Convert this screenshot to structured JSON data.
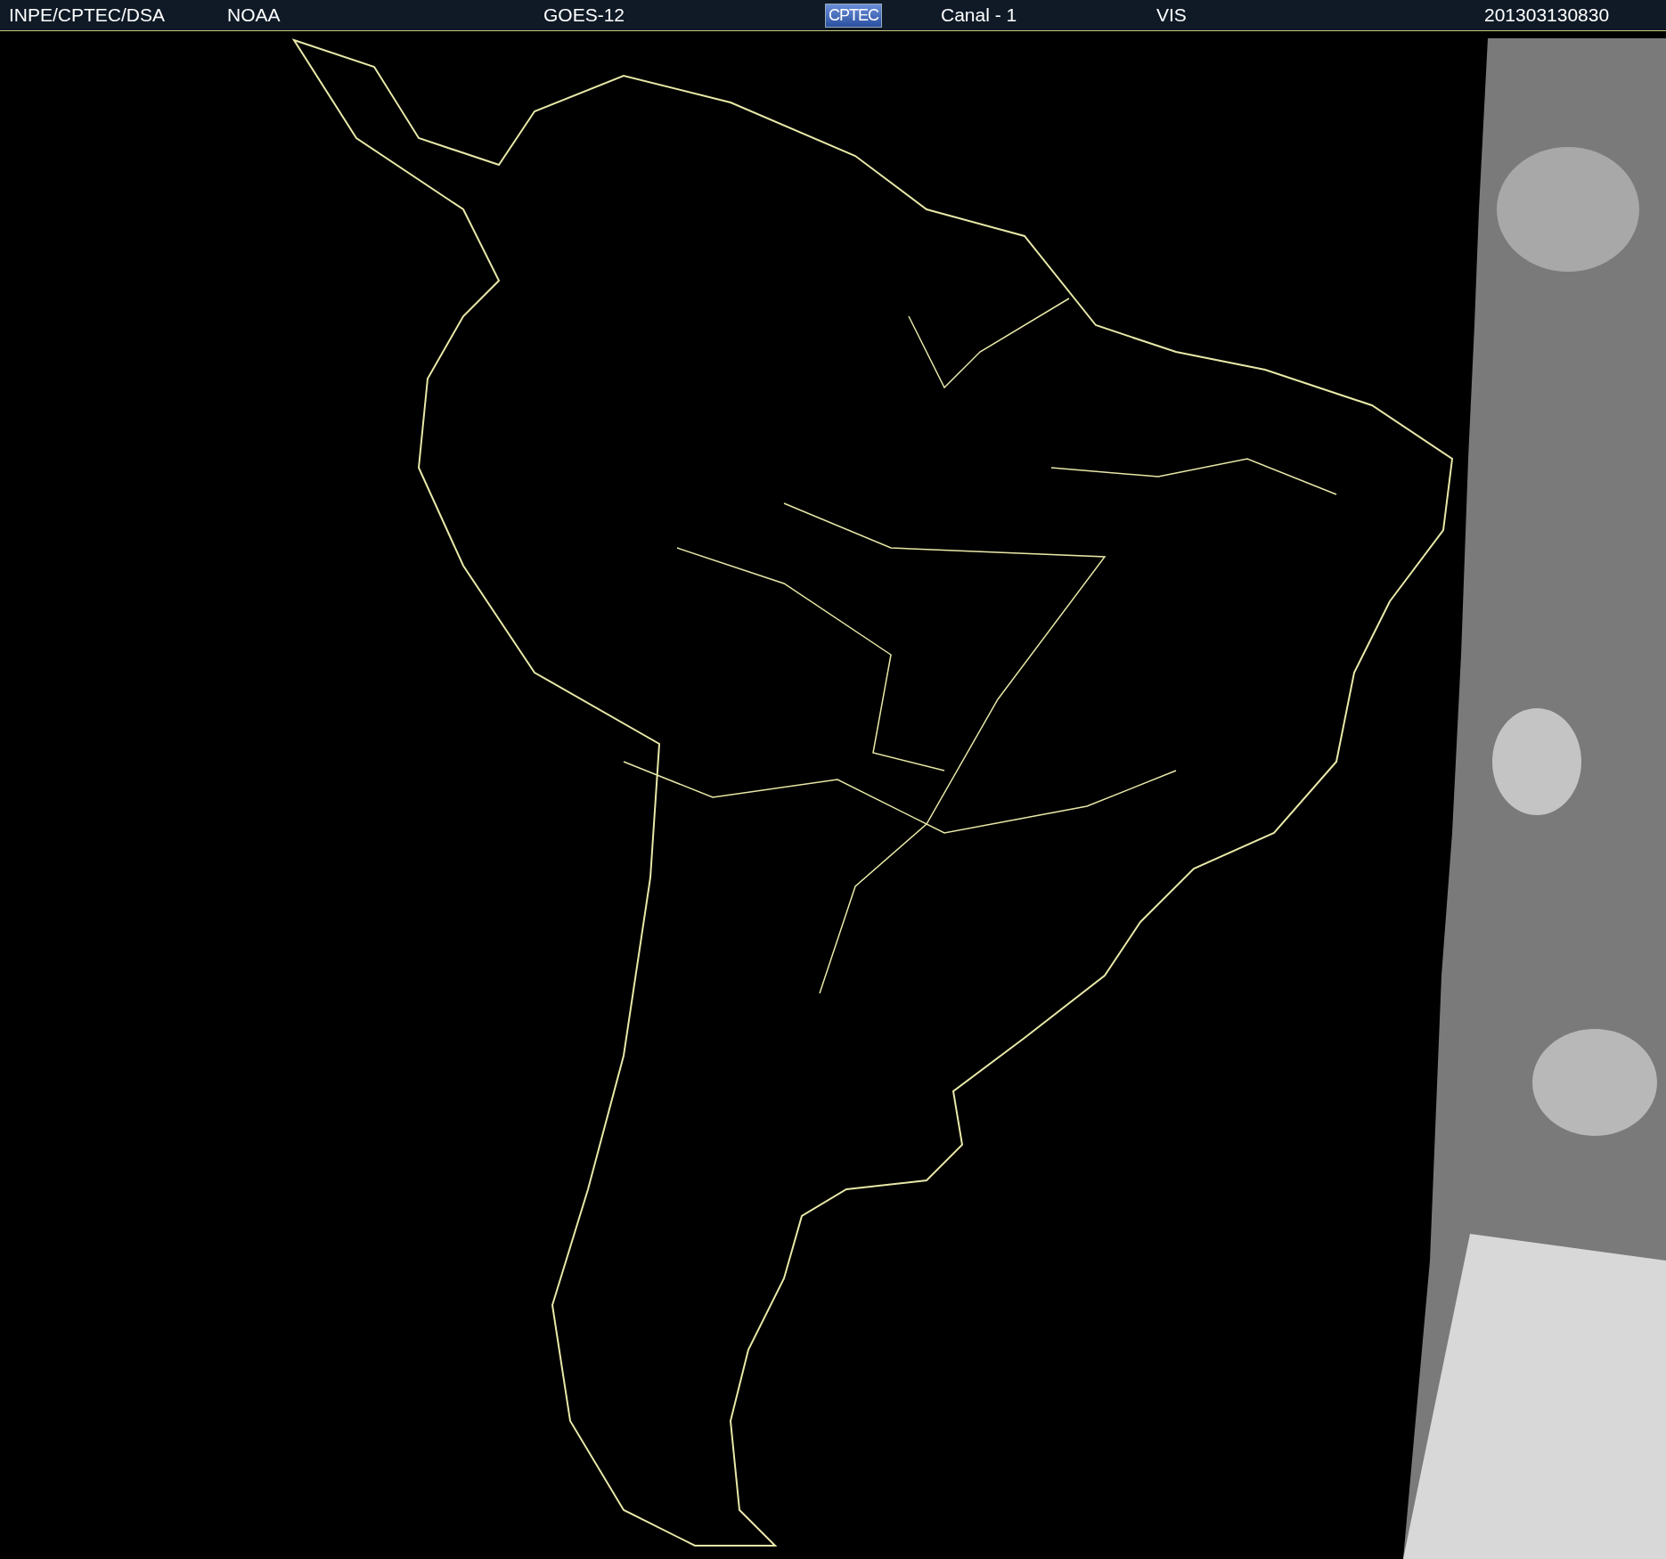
{
  "header": {
    "items": [
      {
        "kind": "text",
        "text": "INPE/CPTEC/DSA"
      },
      {
        "kind": "text",
        "text": "NOAA"
      },
      {
        "kind": "text",
        "text": "GOES-12"
      },
      {
        "kind": "logo",
        "text": "CPTEC"
      },
      {
        "kind": "text",
        "text": "Canal - 1"
      },
      {
        "kind": "text",
        "text": "VIS"
      },
      {
        "kind": "text",
        "text": "201303130830"
      }
    ]
  }
}
